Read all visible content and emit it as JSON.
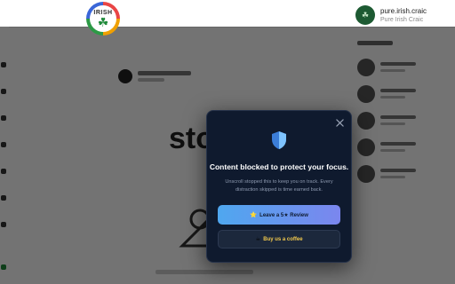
{
  "header": {
    "logo_text": "IRISH",
    "account": {
      "username": "pure.irish.craic",
      "display_name": "Pure Irish Craic"
    }
  },
  "modal": {
    "title": "Content blocked to protect your focus.",
    "body": "Unscroll stopped this to keep you on track. Every distraction skipped is time earned back.",
    "review_button": {
      "icon": "⭐",
      "label": "Leave a 5★ Review"
    },
    "coffee_button": {
      "icon": "☕",
      "label": "Buy us a coffee"
    },
    "close_icon": "close-icon",
    "shield_icon": "shield-icon"
  },
  "colors": {
    "modal_bg": "#0f1a2e",
    "review_gradient_start": "#4fa7ef",
    "review_gradient_end": "#7b86ee",
    "coffee_bg": "#1c283c",
    "coffee_text": "#f2c94c",
    "shield_light": "#7ec3ff",
    "shield_dark": "#3b7dd8"
  }
}
